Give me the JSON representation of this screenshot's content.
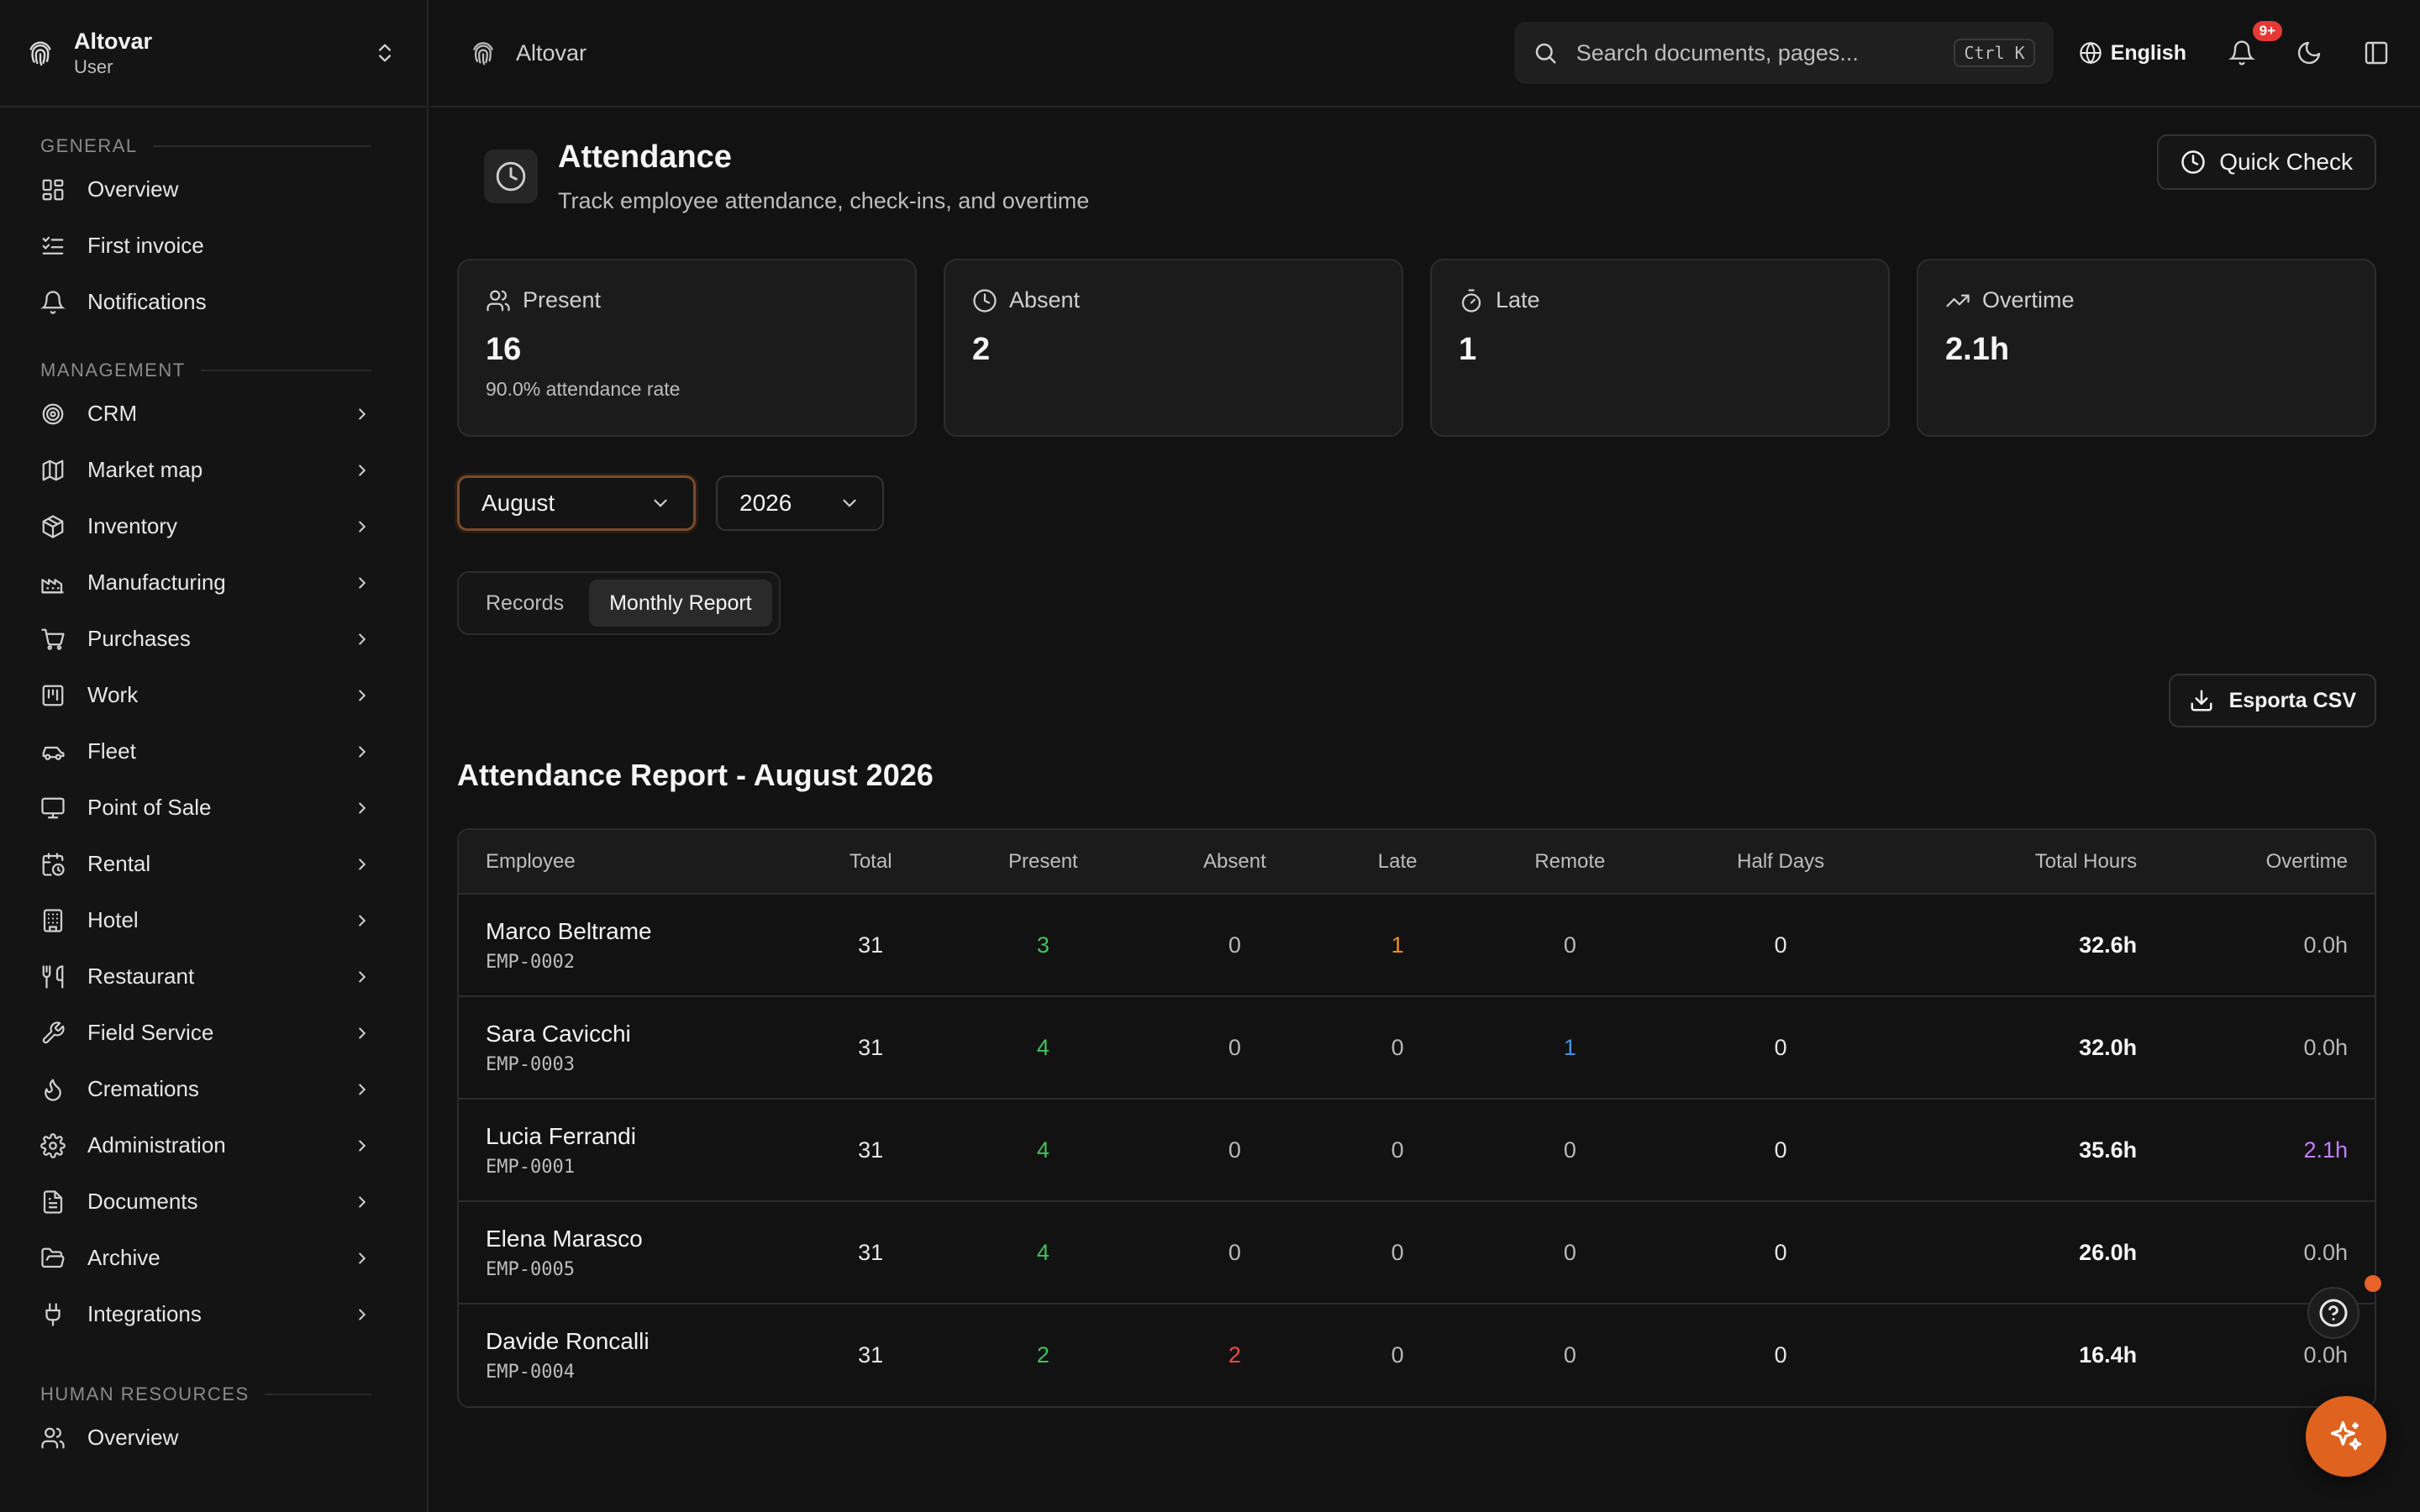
{
  "sidebar": {
    "org_name": "Altovar",
    "org_role": "User",
    "sections": {
      "general": {
        "label": "GENERAL",
        "items": [
          {
            "label": "Overview",
            "icon": "grid-icon"
          },
          {
            "label": "First invoice",
            "icon": "checklist-icon"
          },
          {
            "label": "Notifications",
            "icon": "bell-icon"
          }
        ]
      },
      "management": {
        "label": "MANAGEMENT",
        "items": [
          {
            "label": "CRM",
            "icon": "target-icon"
          },
          {
            "label": "Market map",
            "icon": "map-icon"
          },
          {
            "label": "Inventory",
            "icon": "box-icon"
          },
          {
            "label": "Manufacturing",
            "icon": "factory-icon"
          },
          {
            "label": "Purchases",
            "icon": "cart-icon"
          },
          {
            "label": "Work",
            "icon": "kanban-icon"
          },
          {
            "label": "Fleet",
            "icon": "car-icon"
          },
          {
            "label": "Point of Sale",
            "icon": "monitor-icon"
          },
          {
            "label": "Rental",
            "icon": "calendar-clock-icon"
          },
          {
            "label": "Hotel",
            "icon": "building-icon"
          },
          {
            "label": "Restaurant",
            "icon": "utensils-icon"
          },
          {
            "label": "Field Service",
            "icon": "wrench-icon"
          },
          {
            "label": "Cremations",
            "icon": "flame-icon"
          },
          {
            "label": "Administration",
            "icon": "gear-icon"
          },
          {
            "label": "Documents",
            "icon": "file-icon"
          },
          {
            "label": "Archive",
            "icon": "folder-open-icon"
          },
          {
            "label": "Integrations",
            "icon": "plug-icon"
          }
        ]
      },
      "hr": {
        "label": "HUMAN RESOURCES",
        "items": [
          {
            "label": "Overview",
            "icon": "users-icon"
          }
        ]
      }
    }
  },
  "header": {
    "breadcrumb": "Altovar",
    "search_placeholder": "Search documents, pages...",
    "search_shortcut": "Ctrl K",
    "language": "English",
    "notifications_badge": "9+"
  },
  "page": {
    "title": "Attendance",
    "subtitle": "Track employee attendance, check-ins, and overtime",
    "quick_check_label": "Quick Check"
  },
  "stats": [
    {
      "label": "Present",
      "value": "16",
      "note": "90.0% attendance rate",
      "icon": "users-icon"
    },
    {
      "label": "Absent",
      "value": "2",
      "note": "",
      "icon": "clock-icon"
    },
    {
      "label": "Late",
      "value": "1",
      "note": "",
      "icon": "timer-icon"
    },
    {
      "label": "Overtime",
      "value": "2.1h",
      "note": "",
      "icon": "trending-up-icon"
    }
  ],
  "filters": {
    "month": "August",
    "year": "2026"
  },
  "tabs": [
    {
      "label": "Records",
      "active": false
    },
    {
      "label": "Monthly Report",
      "active": true
    }
  ],
  "export_label": "Esporta CSV",
  "report": {
    "title": "Attendance Report - August 2026",
    "columns": [
      "Employee",
      "Total",
      "Present",
      "Absent",
      "Late",
      "Remote",
      "Half Days",
      "Total Hours",
      "Overtime"
    ],
    "rows": [
      {
        "name": "Marco Beltrame",
        "id": "EMP-0002",
        "total": "31",
        "present": "3",
        "absent": "0",
        "late": "1",
        "remote": "0",
        "half_days": "0",
        "total_hours": "32.6h",
        "overtime": "0.0h"
      },
      {
        "name": "Sara Cavicchi",
        "id": "EMP-0003",
        "total": "31",
        "present": "4",
        "absent": "0",
        "late": "0",
        "remote": "1",
        "half_days": "0",
        "total_hours": "32.0h",
        "overtime": "0.0h"
      },
      {
        "name": "Lucia Ferrandi",
        "id": "EMP-0001",
        "total": "31",
        "present": "4",
        "absent": "0",
        "late": "0",
        "remote": "0",
        "half_days": "0",
        "total_hours": "35.6h",
        "overtime": "2.1h"
      },
      {
        "name": "Elena Marasco",
        "id": "EMP-0005",
        "total": "31",
        "present": "4",
        "absent": "0",
        "late": "0",
        "remote": "0",
        "half_days": "0",
        "total_hours": "26.0h",
        "overtime": "0.0h"
      },
      {
        "name": "Davide Roncalli",
        "id": "EMP-0004",
        "total": "31",
        "present": "2",
        "absent": "2",
        "late": "0",
        "remote": "0",
        "half_days": "0",
        "total_hours": "16.4h",
        "overtime": "0.0h"
      }
    ]
  },
  "colors": {
    "accent": "#e0621f",
    "present": "#3ec35a",
    "late": "#f08b2a",
    "remote": "#4a90e2",
    "absent_alert": "#f04a4a",
    "overtime_alert": "#c77dff"
  }
}
